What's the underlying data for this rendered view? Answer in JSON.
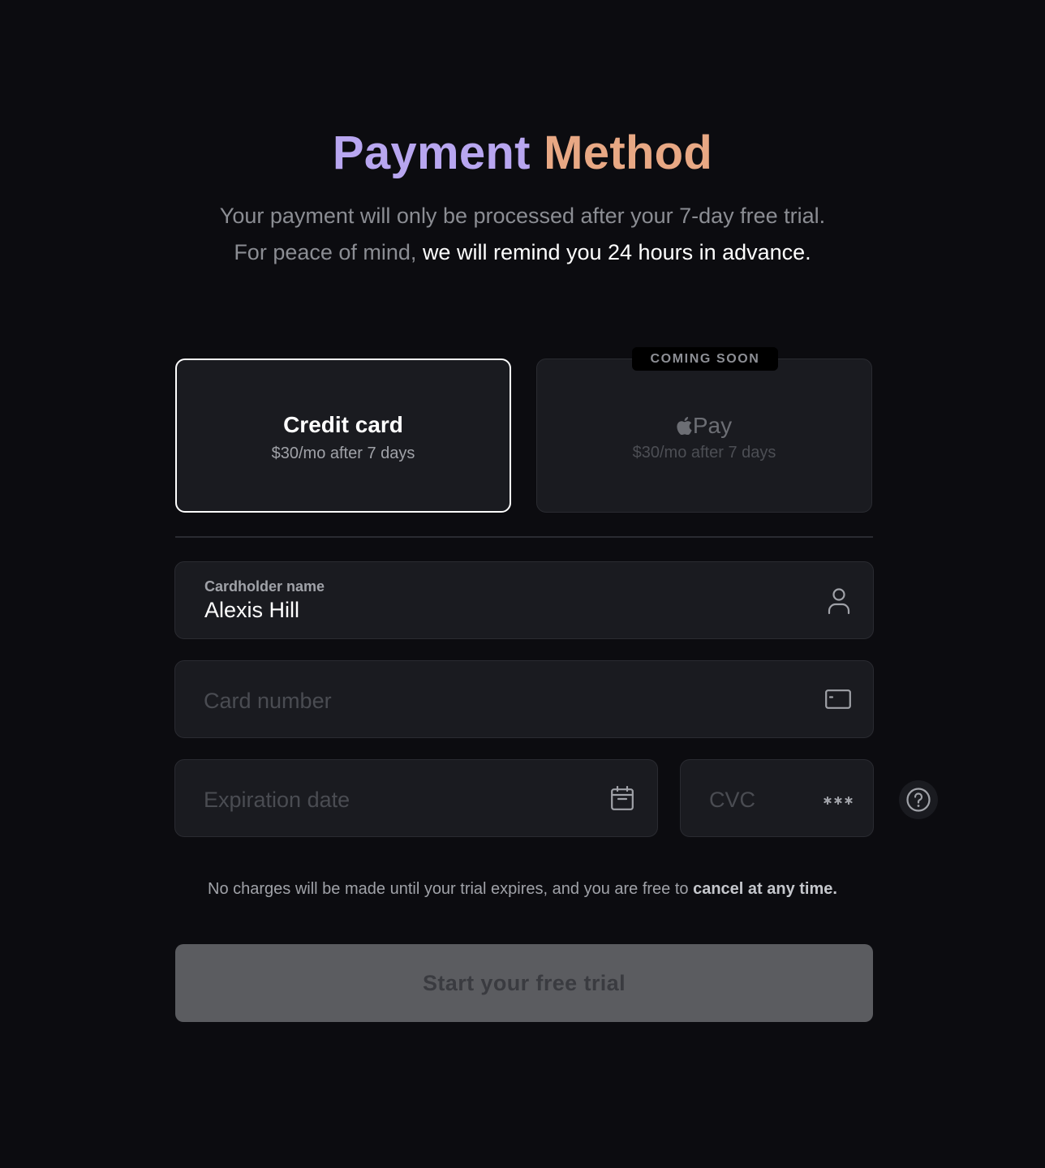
{
  "header": {
    "title_part1": "Payment",
    "title_part2": "Method",
    "subtitle_line1": "Your payment will only be processed after your 7-day free trial.",
    "subtitle_line2_muted": "For peace of mind, ",
    "subtitle_line2_emphasis": "we will remind you 24 hours in advance."
  },
  "payment_options": {
    "credit_card": {
      "title": "Credit card",
      "price": "$30/mo after 7 days",
      "selected": true
    },
    "apple_pay": {
      "title": "Pay",
      "price": "$30/mo after 7 days",
      "badge": "COMING SOON",
      "icon": "apple-icon"
    }
  },
  "form": {
    "cardholder": {
      "label": "Cardholder name",
      "value": "Alexis Hill",
      "icon": "user-icon"
    },
    "card_number": {
      "placeholder": "Card number",
      "icon": "credit-card-icon"
    },
    "expiration": {
      "placeholder": "Expiration date",
      "icon": "calendar-icon"
    },
    "cvc": {
      "placeholder": "CVC",
      "icon": "asterisks-icon"
    },
    "help_icon": "question-circle-icon"
  },
  "notice": {
    "text": "No charges will be made until your trial expires, and you are free to ",
    "emphasis": "cancel at any time."
  },
  "cta": {
    "label": "Start your free trial",
    "enabled": false
  },
  "colors": {
    "background": "#0c0c10",
    "card_bg": "#1a1b20",
    "title_gradient_start": "#b8a6f0",
    "title_gradient_end": "#e8a884",
    "button_disabled": "#5b5c60"
  }
}
